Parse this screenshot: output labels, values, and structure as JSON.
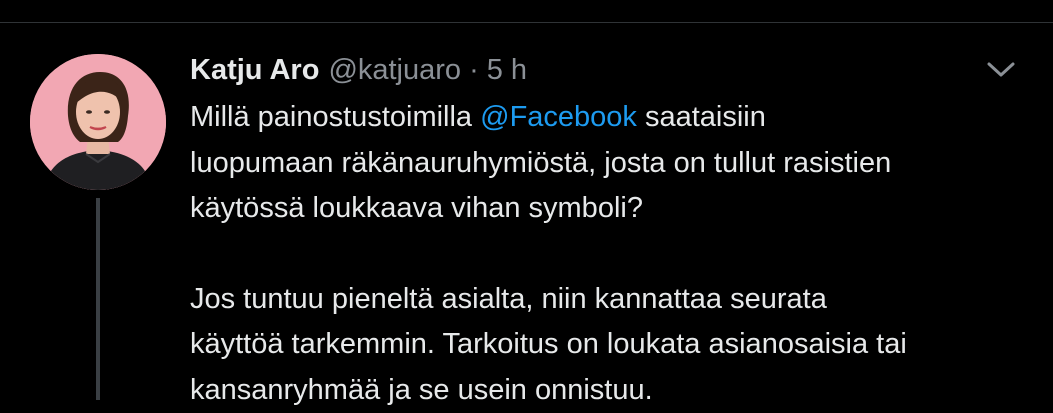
{
  "tweet": {
    "author": {
      "display_name": "Katju Aro",
      "handle": "@katjuaro",
      "avatar_bg": "#f2a7b3"
    },
    "separator": "·",
    "timestamp": "5 h",
    "body": {
      "paragraph_1": {
        "line_1_before": "Millä painostustoimilla ",
        "mention": "@Facebook",
        "line_1_after": " saataisiin",
        "line_2": "luopumaan räkänauruhymiöstä, josta on tullut rasistien",
        "line_3": "käytössä loukkaava vihan symboli?"
      },
      "paragraph_2": {
        "line_1": "Jos tuntuu pieneltä asialta, niin kannattaa seurata",
        "line_2": "käyttöä tarkemmin. Tarkoitus on loukata asianosaisia tai",
        "line_3": "kansanryhmää ja se usein onnistuu."
      }
    },
    "menu_icon": "chevron-down-icon",
    "colors": {
      "background": "#000000",
      "text": "#e7e9ea",
      "secondary_text": "#8b9096",
      "mention": "#1d9bf0",
      "thread_line": "#3a3f44"
    }
  }
}
